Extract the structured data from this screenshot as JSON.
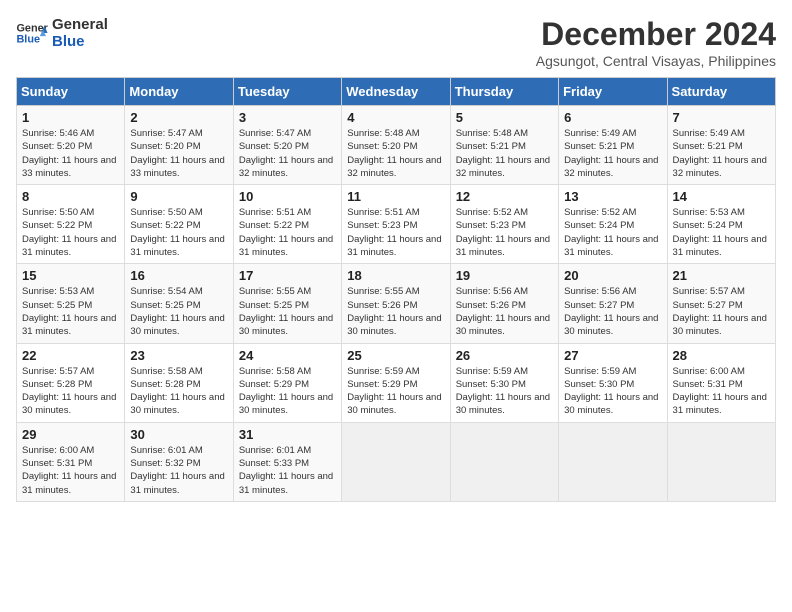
{
  "logo": {
    "line1": "General",
    "line2": "Blue"
  },
  "title": "December 2024",
  "location": "Agsungot, Central Visayas, Philippines",
  "weekdays": [
    "Sunday",
    "Monday",
    "Tuesday",
    "Wednesday",
    "Thursday",
    "Friday",
    "Saturday"
  ],
  "weeks": [
    [
      {
        "day": "1",
        "sunrise": "Sunrise: 5:46 AM",
        "sunset": "Sunset: 5:20 PM",
        "daylight": "Daylight: 11 hours and 33 minutes."
      },
      {
        "day": "2",
        "sunrise": "Sunrise: 5:47 AM",
        "sunset": "Sunset: 5:20 PM",
        "daylight": "Daylight: 11 hours and 33 minutes."
      },
      {
        "day": "3",
        "sunrise": "Sunrise: 5:47 AM",
        "sunset": "Sunset: 5:20 PM",
        "daylight": "Daylight: 11 hours and 32 minutes."
      },
      {
        "day": "4",
        "sunrise": "Sunrise: 5:48 AM",
        "sunset": "Sunset: 5:20 PM",
        "daylight": "Daylight: 11 hours and 32 minutes."
      },
      {
        "day": "5",
        "sunrise": "Sunrise: 5:48 AM",
        "sunset": "Sunset: 5:21 PM",
        "daylight": "Daylight: 11 hours and 32 minutes."
      },
      {
        "day": "6",
        "sunrise": "Sunrise: 5:49 AM",
        "sunset": "Sunset: 5:21 PM",
        "daylight": "Daylight: 11 hours and 32 minutes."
      },
      {
        "day": "7",
        "sunrise": "Sunrise: 5:49 AM",
        "sunset": "Sunset: 5:21 PM",
        "daylight": "Daylight: 11 hours and 32 minutes."
      }
    ],
    [
      {
        "day": "8",
        "sunrise": "Sunrise: 5:50 AM",
        "sunset": "Sunset: 5:22 PM",
        "daylight": "Daylight: 11 hours and 31 minutes."
      },
      {
        "day": "9",
        "sunrise": "Sunrise: 5:50 AM",
        "sunset": "Sunset: 5:22 PM",
        "daylight": "Daylight: 11 hours and 31 minutes."
      },
      {
        "day": "10",
        "sunrise": "Sunrise: 5:51 AM",
        "sunset": "Sunset: 5:22 PM",
        "daylight": "Daylight: 11 hours and 31 minutes."
      },
      {
        "day": "11",
        "sunrise": "Sunrise: 5:51 AM",
        "sunset": "Sunset: 5:23 PM",
        "daylight": "Daylight: 11 hours and 31 minutes."
      },
      {
        "day": "12",
        "sunrise": "Sunrise: 5:52 AM",
        "sunset": "Sunset: 5:23 PM",
        "daylight": "Daylight: 11 hours and 31 minutes."
      },
      {
        "day": "13",
        "sunrise": "Sunrise: 5:52 AM",
        "sunset": "Sunset: 5:24 PM",
        "daylight": "Daylight: 11 hours and 31 minutes."
      },
      {
        "day": "14",
        "sunrise": "Sunrise: 5:53 AM",
        "sunset": "Sunset: 5:24 PM",
        "daylight": "Daylight: 11 hours and 31 minutes."
      }
    ],
    [
      {
        "day": "15",
        "sunrise": "Sunrise: 5:53 AM",
        "sunset": "Sunset: 5:25 PM",
        "daylight": "Daylight: 11 hours and 31 minutes."
      },
      {
        "day": "16",
        "sunrise": "Sunrise: 5:54 AM",
        "sunset": "Sunset: 5:25 PM",
        "daylight": "Daylight: 11 hours and 30 minutes."
      },
      {
        "day": "17",
        "sunrise": "Sunrise: 5:55 AM",
        "sunset": "Sunset: 5:25 PM",
        "daylight": "Daylight: 11 hours and 30 minutes."
      },
      {
        "day": "18",
        "sunrise": "Sunrise: 5:55 AM",
        "sunset": "Sunset: 5:26 PM",
        "daylight": "Daylight: 11 hours and 30 minutes."
      },
      {
        "day": "19",
        "sunrise": "Sunrise: 5:56 AM",
        "sunset": "Sunset: 5:26 PM",
        "daylight": "Daylight: 11 hours and 30 minutes."
      },
      {
        "day": "20",
        "sunrise": "Sunrise: 5:56 AM",
        "sunset": "Sunset: 5:27 PM",
        "daylight": "Daylight: 11 hours and 30 minutes."
      },
      {
        "day": "21",
        "sunrise": "Sunrise: 5:57 AM",
        "sunset": "Sunset: 5:27 PM",
        "daylight": "Daylight: 11 hours and 30 minutes."
      }
    ],
    [
      {
        "day": "22",
        "sunrise": "Sunrise: 5:57 AM",
        "sunset": "Sunset: 5:28 PM",
        "daylight": "Daylight: 11 hours and 30 minutes."
      },
      {
        "day": "23",
        "sunrise": "Sunrise: 5:58 AM",
        "sunset": "Sunset: 5:28 PM",
        "daylight": "Daylight: 11 hours and 30 minutes."
      },
      {
        "day": "24",
        "sunrise": "Sunrise: 5:58 AM",
        "sunset": "Sunset: 5:29 PM",
        "daylight": "Daylight: 11 hours and 30 minutes."
      },
      {
        "day": "25",
        "sunrise": "Sunrise: 5:59 AM",
        "sunset": "Sunset: 5:29 PM",
        "daylight": "Daylight: 11 hours and 30 minutes."
      },
      {
        "day": "26",
        "sunrise": "Sunrise: 5:59 AM",
        "sunset": "Sunset: 5:30 PM",
        "daylight": "Daylight: 11 hours and 30 minutes."
      },
      {
        "day": "27",
        "sunrise": "Sunrise: 5:59 AM",
        "sunset": "Sunset: 5:30 PM",
        "daylight": "Daylight: 11 hours and 30 minutes."
      },
      {
        "day": "28",
        "sunrise": "Sunrise: 6:00 AM",
        "sunset": "Sunset: 5:31 PM",
        "daylight": "Daylight: 11 hours and 31 minutes."
      }
    ],
    [
      {
        "day": "29",
        "sunrise": "Sunrise: 6:00 AM",
        "sunset": "Sunset: 5:31 PM",
        "daylight": "Daylight: 11 hours and 31 minutes."
      },
      {
        "day": "30",
        "sunrise": "Sunrise: 6:01 AM",
        "sunset": "Sunset: 5:32 PM",
        "daylight": "Daylight: 11 hours and 31 minutes."
      },
      {
        "day": "31",
        "sunrise": "Sunrise: 6:01 AM",
        "sunset": "Sunset: 5:33 PM",
        "daylight": "Daylight: 11 hours and 31 minutes."
      },
      null,
      null,
      null,
      null
    ]
  ]
}
